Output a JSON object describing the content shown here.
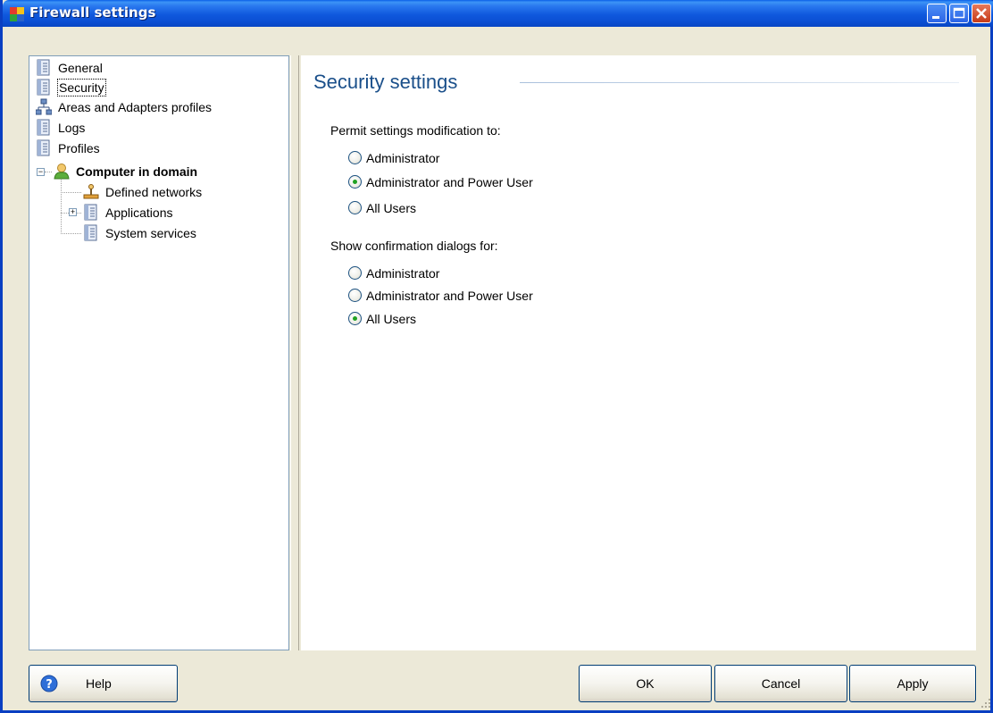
{
  "window": {
    "title": "Firewall settings"
  },
  "tree": {
    "items": [
      {
        "label": "General",
        "icon": "document-icon"
      },
      {
        "label": "Security",
        "icon": "document-icon",
        "selected": true
      },
      {
        "label": "Areas and Adapters profiles",
        "icon": "network-icon"
      },
      {
        "label": "Logs",
        "icon": "document-icon"
      },
      {
        "label": "Profiles",
        "icon": "document-icon"
      },
      {
        "label": "Computer in domain",
        "icon": "user-icon",
        "expanded": true
      },
      {
        "label": "Defined networks",
        "icon": "network-node-icon"
      },
      {
        "label": "Applications",
        "icon": "document-icon",
        "expanded": false
      },
      {
        "label": "System services",
        "icon": "document-icon"
      }
    ]
  },
  "content": {
    "title": "Security settings",
    "permit": {
      "label": "Permit settings modification to:",
      "options": [
        "Administrator",
        "Administrator and Power User",
        "All Users"
      ],
      "selected": "Administrator and Power User"
    },
    "confirm": {
      "label": "Show confirmation dialogs for:",
      "options": [
        "Administrator",
        "Administrator and Power User",
        "All Users"
      ],
      "selected": "All Users"
    }
  },
  "buttons": {
    "help": "Help",
    "ok": "OK",
    "cancel": "Cancel",
    "apply": "Apply"
  },
  "colors": {
    "titlebar": "#0b4fd3",
    "section_title": "#1a4f8a",
    "radio_dot": "#21a121"
  }
}
